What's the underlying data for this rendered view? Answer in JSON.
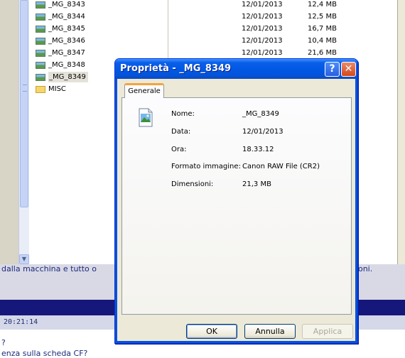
{
  "explorer": {
    "tree_items": [
      {
        "label": "_MG_8343",
        "type": "image"
      },
      {
        "label": "_MG_8344",
        "type": "image"
      },
      {
        "label": "_MG_8345",
        "type": "image"
      },
      {
        "label": "_MG_8346",
        "type": "image"
      },
      {
        "label": "_MG_8347",
        "type": "image"
      },
      {
        "label": "_MG_8348",
        "type": "image"
      },
      {
        "label": "_MG_8349",
        "type": "image",
        "selected": true
      },
      {
        "label": "MISC",
        "type": "folder"
      }
    ],
    "rows": [
      {
        "date": "12/01/2013",
        "size": "12,4 MB"
      },
      {
        "date": "12/01/2013",
        "size": "12,5 MB"
      },
      {
        "date": "12/01/2013",
        "size": "16,7 MB"
      },
      {
        "date": "12/01/2013",
        "size": "10,4 MB"
      },
      {
        "date": "12/01/2013",
        "size": "21,6 MB"
      }
    ]
  },
  "background": {
    "line1_left": "dalla macchina e tutto o",
    "line1_right": "noni.",
    "time": "20:21:14",
    "question": "?",
    "line3": "enza sulla scheda CF?"
  },
  "dialog": {
    "title": "Proprietà - _MG_8349",
    "help_glyph": "?",
    "close_glyph": "✕",
    "tab_label": "Generale",
    "file_icon": "image-file-icon",
    "properties": [
      {
        "label": "Nome:",
        "value": "_MG_8349"
      },
      {
        "label": "Data:",
        "value": "12/01/2013"
      },
      {
        "label": "Ora:",
        "value": "18.33.12"
      },
      {
        "label": "Formato immagine:",
        "value": "Canon RAW File (CR2)"
      },
      {
        "label": "Dimensioni:",
        "value": "21,3 MB"
      }
    ],
    "buttons": {
      "ok": "OK",
      "cancel": "Annulla",
      "apply": "Applica"
    }
  },
  "colors": {
    "titlebar": "#0058e3",
    "tab_accent": "#f5a33b",
    "background_navbar": "#15177a"
  }
}
